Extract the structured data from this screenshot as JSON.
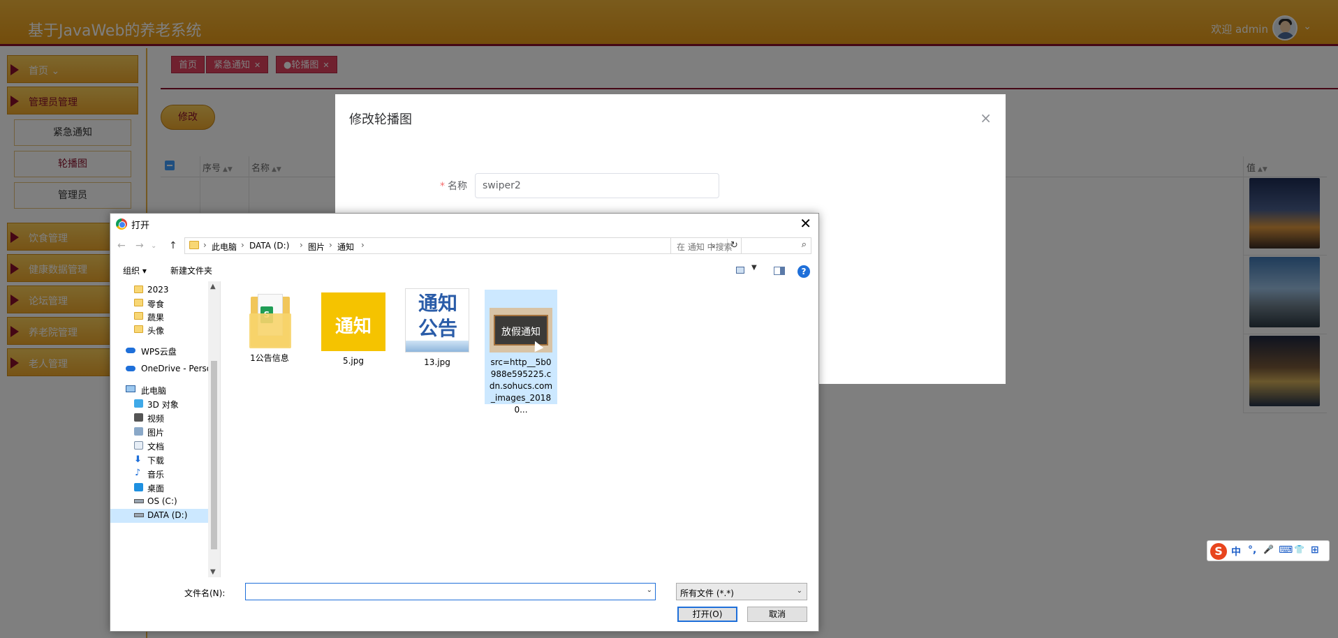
{
  "app": {
    "title": "基于JavaWeb的养老系统",
    "welcome": "欢迎 admin"
  },
  "sidebar": {
    "menus": [
      {
        "label": "首页  ⌄"
      },
      {
        "label": "管理员管理"
      },
      {
        "label": "饮食管理"
      },
      {
        "label": "健康数据管理"
      },
      {
        "label": "论坛管理"
      },
      {
        "label": "养老院管理"
      },
      {
        "label": "老人管理"
      }
    ],
    "submenu": [
      {
        "label": "紧急通知"
      },
      {
        "label": "轮播图"
      },
      {
        "label": "管理员"
      }
    ]
  },
  "tabs": [
    {
      "label": "首页"
    },
    {
      "label": "紧急通知"
    },
    {
      "label": "●轮播图"
    }
  ],
  "toolbar": {
    "modify_label": "修改"
  },
  "table": {
    "headers": [
      "序号",
      "名称",
      "值"
    ]
  },
  "modal": {
    "title": "修改轮播图",
    "close": "×",
    "fields": [
      {
        "label": "名称",
        "value": "swiper2"
      }
    ]
  },
  "file_dialog": {
    "title": "打开",
    "close": "✕",
    "breadcrumb": [
      "此电脑",
      "DATA (D:)",
      "图片",
      "通知"
    ],
    "search_placeholder": "在 通知 中搜索",
    "toolbar": {
      "organize": "组织 ▾",
      "new_folder": "新建文件夹"
    },
    "nav_items": [
      {
        "label": "2023",
        "icon": "folder-icon"
      },
      {
        "label": "零食",
        "icon": "folder-icon"
      },
      {
        "label": "蔬果",
        "icon": "folder-icon"
      },
      {
        "label": "头像",
        "icon": "folder-icon"
      },
      {
        "label": "WPS云盘",
        "icon": "cloud-icon"
      },
      {
        "label": "OneDrive - Perso",
        "icon": "cloud-icon"
      },
      {
        "label": "此电脑",
        "icon": "computer-icon"
      },
      {
        "label": "3D 对象",
        "icon": "3d-icon"
      },
      {
        "label": "视频",
        "icon": "video-icon"
      },
      {
        "label": "图片",
        "icon": "picture-icon"
      },
      {
        "label": "文档",
        "icon": "document-icon"
      },
      {
        "label": "下载",
        "icon": "download-icon"
      },
      {
        "label": "音乐",
        "icon": "music-icon"
      },
      {
        "label": "桌面",
        "icon": "desktop-icon"
      },
      {
        "label": "OS (C:)",
        "icon": "drive-icon"
      },
      {
        "label": "DATA (D:)",
        "icon": "drive-icon"
      }
    ],
    "files": [
      {
        "label": "1公告信息",
        "kind": "folder"
      },
      {
        "label": "5.jpg",
        "kind": "image",
        "thumb_text": "通知"
      },
      {
        "label": "13.jpg",
        "kind": "image",
        "thumb_text_1": "通知",
        "thumb_text_2": "公告"
      },
      {
        "label": "src=http__5b0988e595225.cdn.sohucs.com_images_20180...",
        "kind": "image",
        "thumb_text": "放假通知"
      }
    ],
    "filename_label": "文件名(N):",
    "filename_value": "",
    "filetype": "所有文件 (*.*)",
    "open_button": "打开(O)",
    "cancel_button": "取消"
  },
  "ime": {
    "logo": "S",
    "lang": "中",
    "punct": "°,",
    "mic": "🎤",
    "keyboard": "⌨",
    "skin": "👕",
    "apps": "⊞"
  },
  "colors": {
    "header": "#e79a18",
    "accent": "#8b0f2a",
    "tab": "#e0435e",
    "dialog_selection": "#cce8ff",
    "primary_blue": "#1e6fd9"
  }
}
